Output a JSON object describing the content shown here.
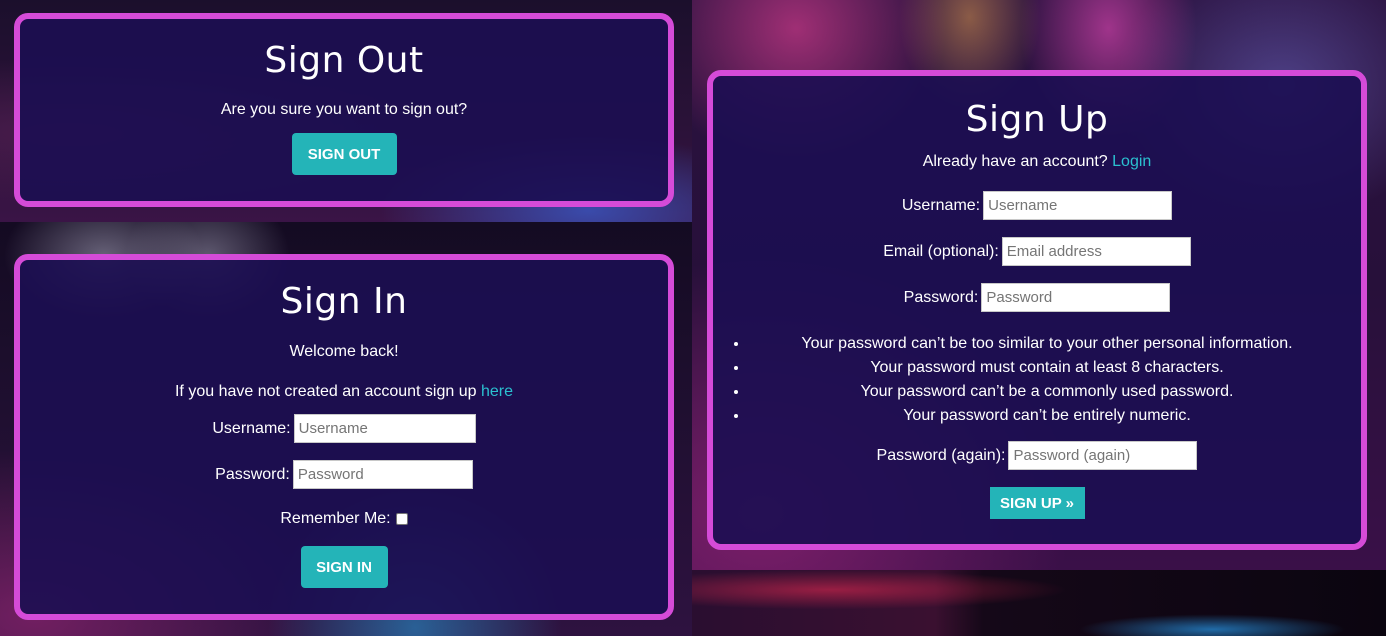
{
  "sign_out": {
    "title": "Sign Out",
    "message": "Are you sure you want to sign out?",
    "button_label": "SIGN OUT"
  },
  "sign_in": {
    "title": "Sign In",
    "welcome": "Welcome back!",
    "no_account_text": "If you have not created an account sign up",
    "signup_link": "here",
    "username_label": "Username:",
    "username_placeholder": "Username",
    "username_value": "",
    "password_label": "Password:",
    "password_placeholder": "Password",
    "password_value": "",
    "remember_label": "Remember Me:",
    "remember_checked": false,
    "button_label": "SIGN IN"
  },
  "sign_up": {
    "title": "Sign Up",
    "already_text": "Already have an account?",
    "login_link": "Login",
    "username_label": "Username:",
    "username_placeholder": "Username",
    "email_label": "Email (optional):",
    "email_placeholder": "Email address",
    "password_label": "Password:",
    "password_placeholder": "Password",
    "password_help": [
      "Your password can’t be too similar to your other personal information.",
      "Your password must contain at least 8 characters.",
      "Your password can’t be a commonly used password.",
      "Your password can’t be entirely numeric."
    ],
    "password2_label": "Password (again):",
    "password2_placeholder": "Password (again)",
    "button_label": "SIGN UP »"
  },
  "colors": {
    "panel_border": "#d54bd8",
    "panel_background": "#1c0e52",
    "button": "#24b4b8",
    "link": "#2bc0d0"
  }
}
